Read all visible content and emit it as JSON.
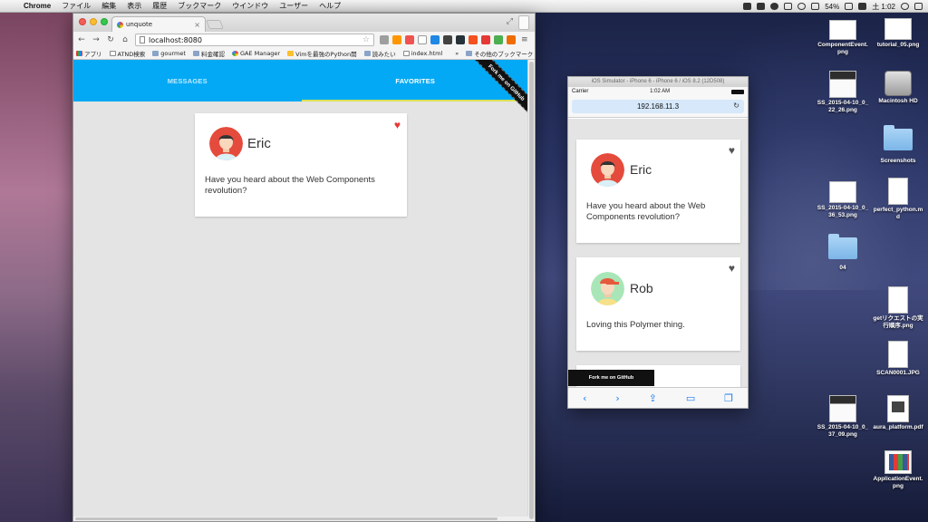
{
  "menubar": {
    "app_name": "Chrome",
    "items": [
      "ファイル",
      "編集",
      "表示",
      "履歴",
      "ブックマーク",
      "ウインドウ",
      "ユーザー",
      "ヘルプ"
    ],
    "battery": "54%",
    "clock": "土 1:02"
  },
  "browser": {
    "tab_title": "unquote",
    "url": "localhost:8080",
    "bookmarks": [
      "アプリ",
      "ATND検索",
      "gourmet",
      "料金確認",
      "GAE Manager",
      "Vimを最強のPython開",
      "読みたい",
      "index.html"
    ],
    "bookmarks_more": "»",
    "other_bookmarks": "その他のブックマーク"
  },
  "app": {
    "tabs": [
      "MESSAGES",
      "FAVORITES"
    ],
    "active_tab": "FAVORITES",
    "fork_ribbon": "Fork me on GitHub",
    "accent_color": "#03a9f4"
  },
  "favorites": [
    {
      "name": "Eric",
      "message": "Have you heard about the Web Components revolution?",
      "favorite": true
    }
  ],
  "simulator": {
    "title": "iOS Simulator - iPhone 6 - iPhone 6 / iOS 8.2 (12D508)",
    "carrier": "Carrier",
    "time": "1:02 AM",
    "url": "192.168.11.3",
    "fork_label": "Fork me on GitHub",
    "messages": [
      {
        "name": "Eric",
        "message": "Have you heard about the Web Components revolution?",
        "favorite": false
      },
      {
        "name": "Rob",
        "message": "Loving this Polymer thing.",
        "favorite": false
      }
    ]
  },
  "desktop_icons": [
    "ComponentEvent.png",
    "tutorial_05.png",
    "SS_2015-04-10_0_22_26.png",
    "Macintosh HD",
    "Screenshots",
    "SS_2015-04-10_0_36_53.png",
    "perfect_python.md",
    "04",
    "getリクエストの実行順序.png",
    "SCAN0001.JPG",
    "SS_2015-04-10_0_37_09.png",
    "aura_platform.pdf",
    "ApplicationEvent.png"
  ]
}
